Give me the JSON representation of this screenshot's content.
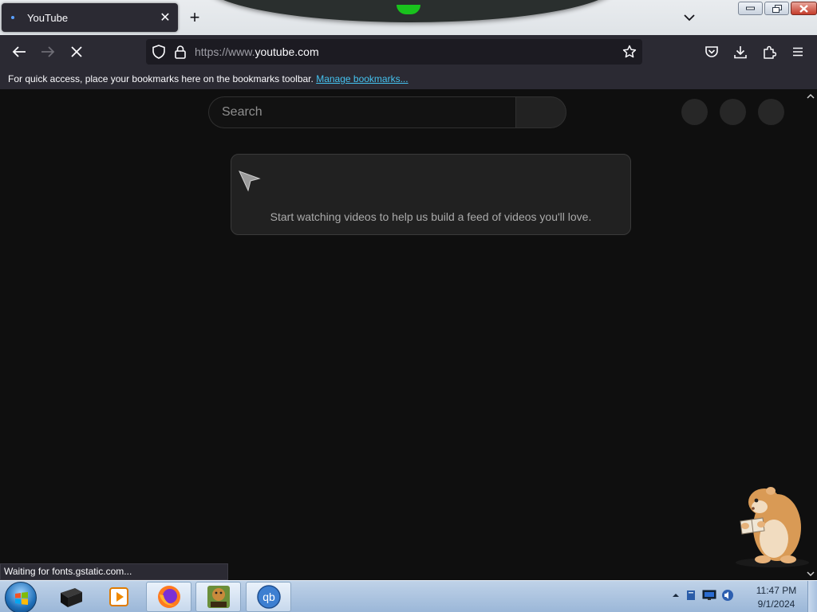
{
  "browser": {
    "tab": {
      "title": "YouTube"
    },
    "url": {
      "prefix": "https://www.",
      "host": "youtube.com"
    },
    "bookmarks_bar": {
      "message": "For quick access, place your bookmarks here on the bookmarks toolbar.",
      "link": "Manage bookmarks..."
    },
    "status": "Waiting for fonts.gstatic.com..."
  },
  "youtube": {
    "search": {
      "placeholder": "Search"
    },
    "feed_message": "Start watching videos to help us build a feed of videos you'll love."
  },
  "taskbar": {
    "clock": {
      "time": "11:47 PM",
      "date": "9/1/2024"
    },
    "apps": [
      "black-box-app",
      "media-player",
      "firefox",
      "box-game",
      "qbittorrent"
    ],
    "qb_label": "qb"
  },
  "colors": {
    "page_bg": "#0f0f0f",
    "toolbar_bg": "#2b2a33",
    "link": "#45c2ef",
    "theme_green": "#19c21d"
  }
}
